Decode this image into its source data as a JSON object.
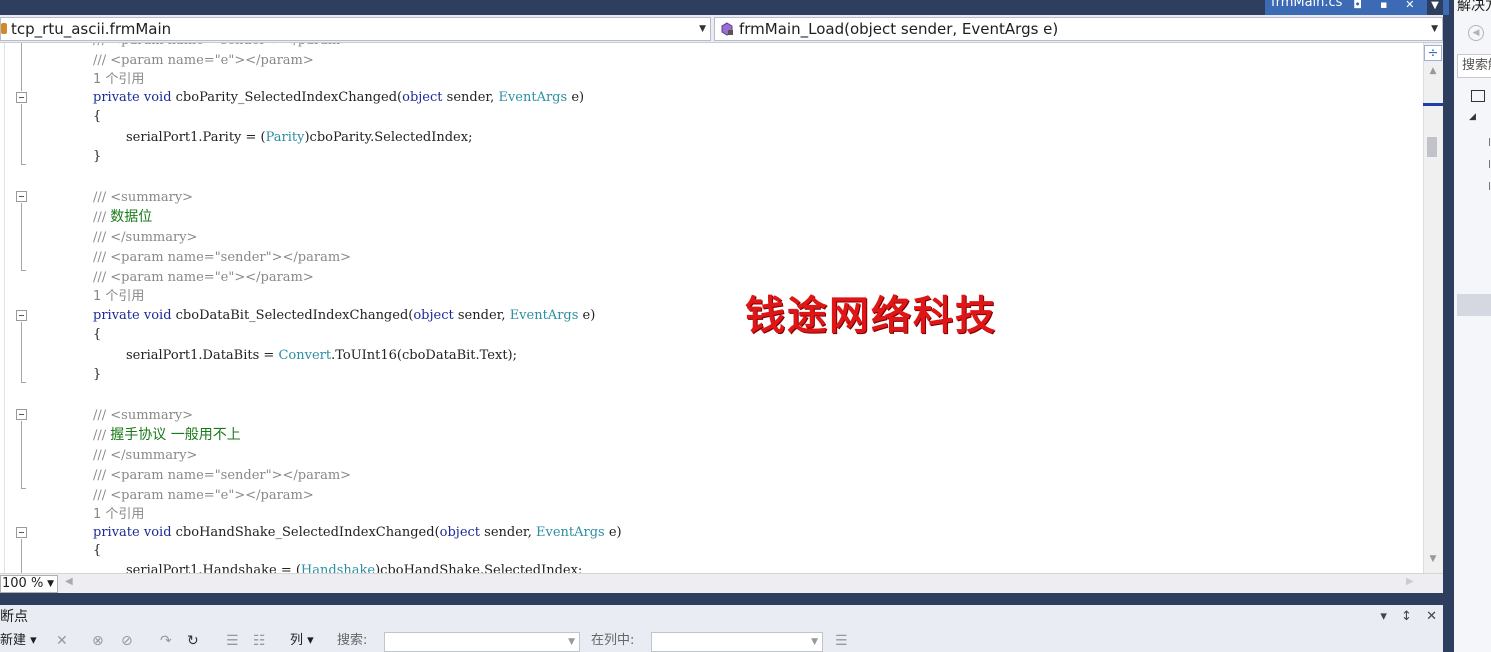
{
  "document_tab": {
    "title": "frmMain.cs",
    "pin": "◘",
    "keep": "▪",
    "close": "✕"
  },
  "nav": {
    "class_combo": "tcp_rtu_ascii.frmMain",
    "member_combo": "frmMain_Load(object sender, EventArgs e)"
  },
  "code": {
    "line_top_partial": "/// <param name=\"sender\"></param>",
    "param_e": "/// <param name=\"e\"></param>",
    "param_sender": "/// <param name=\"sender\"></param>",
    "summary_open": "/// <summary>",
    "summary_close": "/// </summary>",
    "ref_count": "1 个引用",
    "comment_prefix": "/// ",
    "comment_databits": "数据位",
    "comment_handshake": "握手协议 一般用不上",
    "kw_private": "private",
    "kw_void": "void",
    "kw_object": "object",
    "type_eventargs": "EventArgs",
    "type_parity": "Parity",
    "type_convert": "Convert",
    "type_handshake": "Handshake",
    "m1_name": "cboParity_SelectedIndexChanged(",
    "m2_name": "cboDataBit_SelectedIndexChanged(",
    "m3_name": "cboHandShake_SelectedIndexChanged(",
    "sig_sender": " sender, ",
    "sig_e": " e)",
    "brace_open": "{",
    "brace_close": "}",
    "parity_stmt_pre": "serialPort1.Parity = (",
    "parity_stmt_post": ")cboParity.SelectedIndex;",
    "databits_stmt_pre": "serialPort1.DataBits = ",
    "databits_stmt_post": ".ToUInt16(cboDataBit.Text);",
    "handshake_stmt_pre": "serialPort1.Handshake = (",
    "handshake_stmt_post": ")cboHandShake.SelectedIndex;"
  },
  "watermark": "钱途网络科技",
  "zoom": "100 %",
  "bottom_panel": {
    "title": "断点",
    "buttons": [
      "▾",
      "↕",
      "✕"
    ],
    "new_label": "新建 ▾",
    "columns_label": "列 ▾",
    "search_label": "搜索:",
    "in_column_label": "在列中:"
  },
  "solution_panel": {
    "title": "解决方案资源管理器",
    "search_placeholder": "搜索解决方案资源管理器"
  },
  "colors": {
    "accent": "#3c6ab5",
    "keyword": "#1b2a9a",
    "type": "#2b8fa3",
    "comment_text": "#1a7a1a",
    "watermark": "#e01616"
  }
}
